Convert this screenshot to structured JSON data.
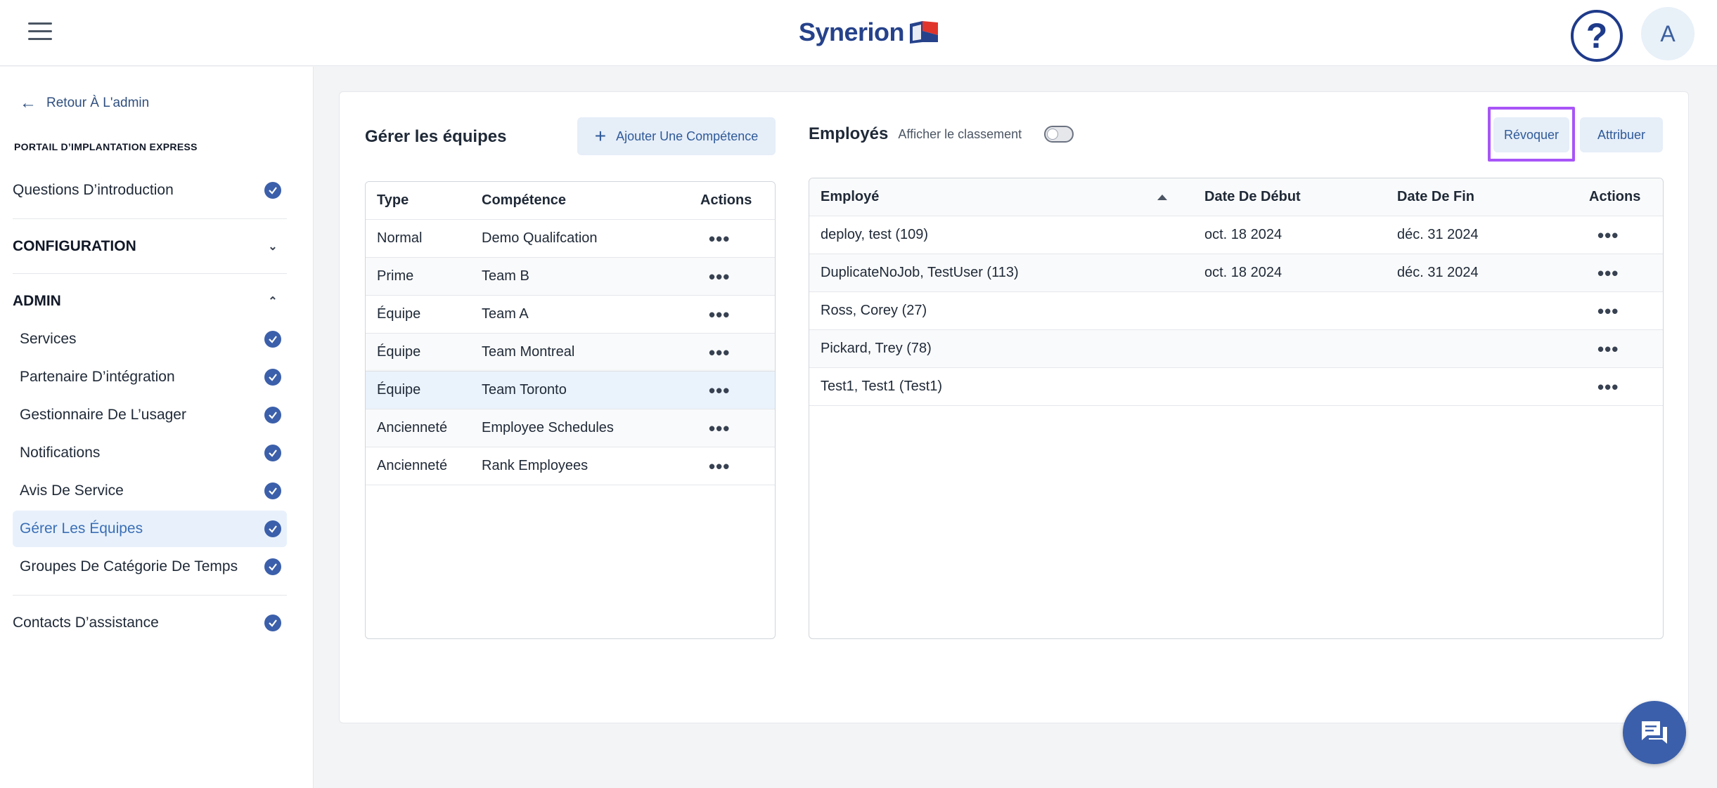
{
  "header": {
    "brand": "Synerion",
    "help_glyph": "?",
    "avatar_initial": "A",
    "colors": {
      "brand_blue": "#26428b",
      "brand_red": "#e0352b"
    }
  },
  "sidebar": {
    "back_label": "Retour À L'admin",
    "portal_title": "PORTAIL D’IMPLANTATION EXPRESS",
    "intro": "Questions D’introduction",
    "configuration": "CONFIGURATION",
    "admin": "ADMIN",
    "admin_items": [
      "Services",
      "Partenaire D’intégration",
      "Gestionnaire De L’usager",
      "Notifications",
      "Avis De Service",
      "Gérer Les Équipes",
      "Groupes De Catégorie De Temps"
    ],
    "active_item": "Gérer Les Équipes",
    "support": "Contacts D’assistance"
  },
  "teams": {
    "title": "Gérer les équipes",
    "add_button": "Ajouter Une Compétence",
    "columns": [
      "Type",
      "Compétence",
      "Actions"
    ],
    "rows": [
      {
        "type": "Normal",
        "skill": "Demo Qualifcation"
      },
      {
        "type": "Prime",
        "skill": "Team B"
      },
      {
        "type": "Équipe",
        "skill": "Team A"
      },
      {
        "type": "Équipe",
        "skill": "Team Montreal"
      },
      {
        "type": "Équipe",
        "skill": "Team Toronto"
      },
      {
        "type": "Ancienneté",
        "skill": "Employee Schedules"
      },
      {
        "type": "Ancienneté",
        "skill": "Rank Employees"
      }
    ],
    "selected_row": "Team Toronto"
  },
  "employees": {
    "title": "Employés",
    "toggle_label": "Afficher le classement",
    "toggle_on": false,
    "revoke_button": "Révoquer",
    "assign_button": "Attribuer",
    "columns": [
      "Employé",
      "Date De Début",
      "Date De Fin",
      "Actions"
    ],
    "rows": [
      {
        "name": "deploy, test (109)",
        "start": "oct. 18 2024",
        "end": "déc. 31 2024"
      },
      {
        "name": "DuplicateNoJob, TestUser (113)",
        "start": "oct. 18 2024",
        "end": "déc. 31 2024"
      },
      {
        "name": "Ross, Corey (27)",
        "start": "",
        "end": ""
      },
      {
        "name": "Pickard, Trey (78)",
        "start": "",
        "end": ""
      },
      {
        "name": "Test1, Test1 (Test1)",
        "start": "",
        "end": ""
      }
    ],
    "sort_column": "Employé",
    "sort_direction": "ascending"
  },
  "actions_glyph": "•••",
  "chat_icon": "chat-bubble-icon"
}
